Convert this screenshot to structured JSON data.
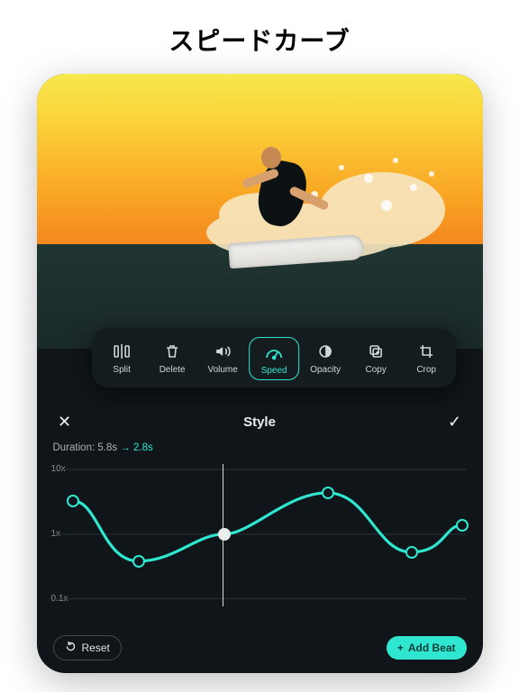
{
  "page": {
    "title": "スピードカーブ"
  },
  "toolbar": {
    "items": [
      {
        "id": "split",
        "label": "Split"
      },
      {
        "id": "delete",
        "label": "Delete"
      },
      {
        "id": "volume",
        "label": "Volume"
      },
      {
        "id": "speed",
        "label": "Speed",
        "active": true
      },
      {
        "id": "opacity",
        "label": "Opacity"
      },
      {
        "id": "copy",
        "label": "Copy"
      },
      {
        "id": "crop",
        "label": "Crop"
      }
    ]
  },
  "panel": {
    "title": "Style",
    "duration_label": "Duration:",
    "duration_from": "5.8s",
    "duration_arrow": "→",
    "duration_to": "2.8s"
  },
  "chart_data": {
    "type": "line",
    "xlabel": "",
    "ylabel": "",
    "ylim": [
      0.1,
      10
    ],
    "ytick_labels": [
      "10x",
      "1x",
      "0.1x"
    ],
    "x": [
      0.0,
      0.16,
      0.41,
      0.66,
      0.86,
      1.0
    ],
    "values": [
      3.0,
      0.4,
      1.0,
      4.0,
      0.7,
      1.5
    ],
    "playhead_x": 0.41
  },
  "footer": {
    "reset": "Reset",
    "add_beat": "Add Beat",
    "add_beat_prefix": "+"
  },
  "colors": {
    "accent": "#2fe7d0"
  }
}
